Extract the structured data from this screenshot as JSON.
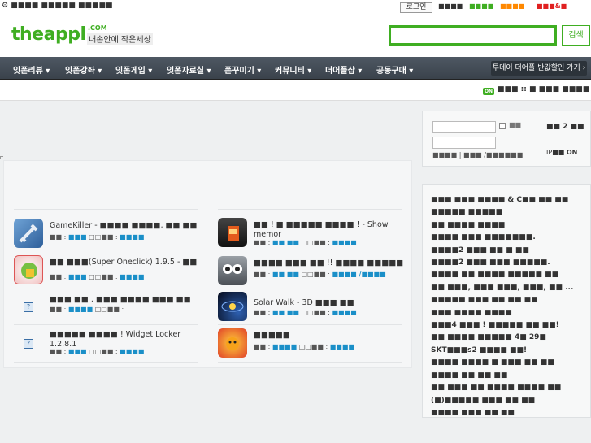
{
  "topbar": {
    "tagline": "■■■■ ■■■■■ ■■■■■",
    "login_label": "로그인",
    "swatches": [
      {
        "text": "■■■■",
        "color": "#333333"
      },
      {
        "text": "■■■■",
        "color": "#3fae22"
      },
      {
        "text": "■■■■",
        "color": "#ff8800"
      },
      {
        "text": "■■■&■",
        "color": "#e02020"
      }
    ]
  },
  "header": {
    "logo_text": "theappl",
    "logo_com": ".COM",
    "logo_sub": "내손안에 작은세상",
    "search_placeholder": "",
    "search_button": "검색"
  },
  "nav": {
    "items": [
      "잇폰리뷰 ▾",
      "잇폰강좌 ▾",
      "잇폰게임 ▾",
      "잇폰자료실 ▾",
      "폰꾸미기 ▾",
      "커뮤니티 ▾",
      "더어플샵 ▾",
      "공동구매 ▾"
    ],
    "promo": "투데이 더어플 반값할인 가기 ›"
  },
  "strip": {
    "badge": "ON",
    "text": "■■■ :: ■ ■■■ ■■■■"
  },
  "apps": [
    {
      "title": "GameKiller - ■■■■ ■■■■, ■■ ■■",
      "meta_pre": "■■ : ",
      "meta_blue": "■■■",
      "meta_mid": "□□■■ : ",
      "meta_blue2": "■■■■",
      "icon": "syringe-icon"
    },
    {
      "title": "■■ ■■■(Super Oneclick) 1.9.5 - ■■ ■",
      "meta_pre": "■■ : ",
      "meta_blue": "■■■",
      "meta_mid": "□□■■ : ",
      "meta_blue2": "■■■■",
      "icon": "android-icon"
    },
    {
      "title": "■■■ ■■ . ■■■ ■■■■ ■■■ ■■",
      "meta_pre": "■■ : ",
      "meta_blue": "■■■■",
      "meta_mid": "□□■■ :",
      "meta_blue2": "",
      "icon": "placeholder-icon"
    },
    {
      "title": "■■■■■ ■■■■ ! Widget Locker 1.2.8.1",
      "meta_pre": "■■ : ",
      "meta_blue": "■■■",
      "meta_mid": "□□■■ : ",
      "meta_blue2": "■■■■",
      "icon": "placeholder-icon"
    },
    {
      "title": "■■ ! ■ ■■■■■ ■■■■ ! - Show memor",
      "meta_pre": "■■ : ",
      "meta_blue": "■■ ■■",
      "meta_mid": "□□■■ : ",
      "meta_blue2": "■■■■",
      "icon": "drink-icon"
    },
    {
      "title": "■■■■ ■■■ ■■ !! ■■■■ ■■■■■",
      "meta_pre": "■■ : ",
      "meta_blue": "■■ ■■",
      "meta_mid": "□□■■ : ",
      "meta_blue2": "■■■■ /■■■■",
      "icon": "owl-icon"
    },
    {
      "title": "Solar Walk - 3D ■■■ ■■",
      "meta_pre": "■■ : ",
      "meta_blue": "■■ ■■",
      "meta_mid": "□□■■ : ",
      "meta_blue2": "■■■■",
      "icon": "solar-icon"
    },
    {
      "title": "■■■■■",
      "meta_pre": "■■ : ",
      "meta_blue": "■■■■",
      "meta_mid": "□□■■ : ",
      "meta_blue2": "■■■■",
      "icon": "lion-icon"
    }
  ],
  "side_login": {
    "checkbox_label": "■■",
    "links": "■■■■ | ■■■ /■■■■■■",
    "count": "■■ 2 ■■",
    "ip_label": "IP■■",
    "ip_state": "ON"
  },
  "side_news": {
    "lines": [
      "■■■ ■■■ ■■■■ & C■■ ■■ ■■",
      "■■■■■ ■■■■■",
      "■■ ■■■■ ■■■■",
      "■■■■ ■■■ ■■■■■■■.",
      "■■■■2 ■■■ ■■ ■ ■■",
      "■■■■2 ■■■ ■■■ ■■■■■.",
      "■■■■ ■■ ■■■■ ■■■■■ ■■",
      "■■ ■■■, ■■■ ■■■, ■■■, ■■ ...",
      "■■■■■ ■■■ ■■ ■■ ■■",
      "■■■ ■■■■ ■■■■",
      "■■■4 ■■■ ! ■■■■■ ■■ ■■!",
      "■■ ■■■■ ■■■■■ 4■ 29■",
      "SKT■■■s2 ■■■■ ■■!",
      "■■■■ ■■■■ ■ ■■■ ■■ ■■",
      "■■■■ ■■ ■■ ■■",
      "■■ ■■■ ■■ ■■■■ ■■■■ ■■",
      "(■)■■■■■ ■■■ ■■ ■■",
      "■■■■ ■■■ ■■ ■■"
    ]
  }
}
